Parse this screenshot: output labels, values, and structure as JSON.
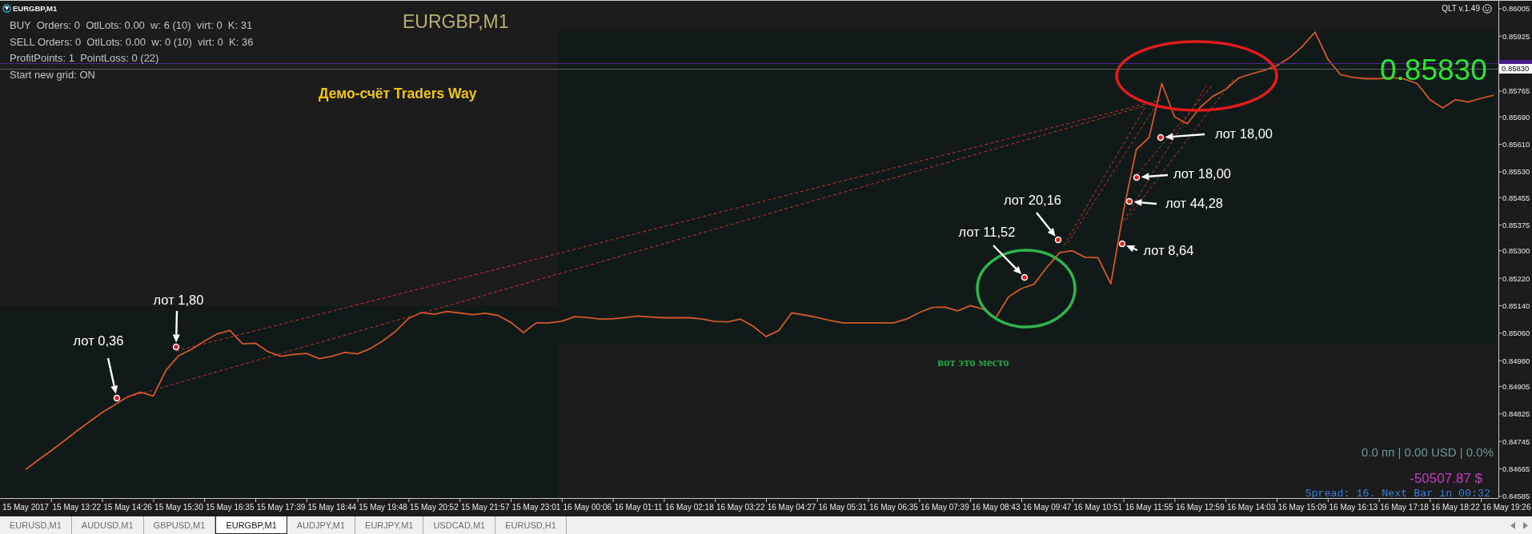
{
  "window": {
    "title": "EURGBP,M1",
    "version": "QLT v.1.49"
  },
  "chart": {
    "info_lines": [
      "BUY  Orders: 0  OtlLots: 0.00  w: 6 (10)  virt: 0  K: 31",
      "SELL Orders: 0  OtlLots: 0.00  w: 0 (10)  virt: 0  K: 36",
      "ProfitPoints: 1  PointLoss: 0 (22)",
      "Start new grid: ON"
    ],
    "symbol": "EURGBP,M1",
    "account_label": "Демо-счёт Traders Way",
    "big_price": "0.85830",
    "price_tag": "0.85830",
    "lot_labels": [
      "лот 18,00",
      "лот 18,00",
      "лот 20,16",
      "лот 44,28",
      "лот 11,52",
      "лот 8,64",
      "лот 1,80",
      "лот 0,36"
    ],
    "note": "вот это место",
    "profit_summary": "0.0 пп | 0.00 USD | 0.0%",
    "balance": "-50507.87 $",
    "spread_info": "Spread: 16. Next Bar in 00:32",
    "chart_data": {
      "type": "line",
      "categories": [
        "15 May 2017",
        null,
        null,
        null,
        "15 May 13:22",
        null,
        null,
        null,
        "15 May 14:26",
        null,
        null,
        null,
        "15 May 15:30",
        null,
        null,
        null,
        "15 May 16:35",
        null,
        null,
        null,
        "15 May 17:39",
        null,
        null,
        null,
        "15 May 18:44",
        null,
        null,
        null,
        "15 May 19:48",
        null,
        null,
        null,
        "15 May 20:52",
        null,
        null,
        null,
        "15 May 21:57",
        null,
        null,
        null,
        "15 May 23:01",
        null,
        null,
        null,
        "16 May 00:06",
        null,
        null,
        null,
        "16 May 01:11",
        null,
        null,
        null,
        "16 May 02:18",
        null,
        null,
        null,
        "16 May 03:22",
        null,
        null,
        null,
        "16 May 04:27",
        null,
        null,
        null,
        "16 May 05:31",
        null,
        null,
        null,
        "16 May 06:35",
        null,
        null,
        null,
        "16 May 07:39",
        null,
        null,
        null,
        "16 May 08:43",
        null,
        null,
        null,
        "16 May 09:47",
        null,
        null,
        null,
        "16 May 10:51",
        null,
        null,
        null,
        "16 May 11:55",
        null,
        null,
        null,
        "16 May 12:59",
        null,
        null,
        null,
        "16 May 14:03",
        null,
        null,
        null,
        "16 May 15:09",
        null,
        null,
        null,
        "16 May 16:13",
        null,
        null,
        null,
        "16 May 17:18",
        null,
        null,
        null,
        "16 May 18:22",
        null,
        null,
        null,
        "16 May 19:26",
        null
      ],
      "series": [
        {
          "color": "#d4572a",
          "values": [
            0.84663,
            0.84691,
            0.84718,
            0.84746,
            0.84775,
            0.84802,
            0.84829,
            0.84852,
            0.84875,
            0.84888,
            0.84877,
            0.84952,
            0.84995,
            0.85013,
            0.85037,
            0.85058,
            0.85068,
            0.85029,
            0.85031,
            0.85006,
            0.84993,
            0.84998,
            0.85001,
            0.84986,
            0.84993,
            0.85004,
            0.85,
            0.85015,
            0.85038,
            0.85066,
            0.85103,
            0.8512,
            0.85115,
            0.85123,
            0.85119,
            0.85114,
            0.85118,
            0.85112,
            0.85092,
            0.85062,
            0.8509,
            0.8509,
            0.85095,
            0.85108,
            0.85106,
            0.85101,
            0.85102,
            0.85106,
            0.8511,
            0.85107,
            0.85105,
            0.85105,
            0.85105,
            0.85101,
            0.85094,
            0.85093,
            0.85101,
            0.8508,
            0.8505,
            0.85068,
            0.85119,
            0.85113,
            0.85106,
            0.85097,
            0.8509,
            0.8509,
            0.8509,
            0.8509,
            0.8509,
            0.85101,
            0.8512,
            0.85135,
            0.85136,
            0.85125,
            0.8514,
            0.8513,
            0.85105,
            0.85166,
            0.8519,
            0.85203,
            0.85252,
            0.85295,
            0.853,
            0.85281,
            0.8528,
            0.85204,
            0.85417,
            0.85595,
            0.8563,
            0.85787,
            0.8569,
            0.8567,
            0.85718,
            0.8575,
            0.8577,
            0.85803,
            0.85815,
            0.85825,
            0.85839,
            0.85862,
            0.85895,
            0.85937,
            0.85858,
            0.85813,
            0.85805,
            0.85801,
            0.85801,
            0.85805,
            0.858,
            0.85787,
            0.8574,
            0.85716,
            0.8574,
            0.85733,
            0.85744,
            0.85753,
            null,
            null
          ]
        }
      ],
      "ylim": [
        0.8458,
        0.86028
      ],
      "yticks": [
        0.86005,
        0.85925,
        0.85765,
        {
          "value": 0.8569,
          "label": "0.85690"
        },
        {
          "value": 0.8561,
          "label": "0.85610"
        },
        {
          "value": 0.8553,
          "label": "0.85530"
        },
        0.85455,
        0.85375,
        {
          "value": 0.853,
          "label": "0.85300"
        },
        {
          "value": 0.8522,
          "label": "0.85220"
        },
        {
          "value": 0.8514,
          "label": "0.85140"
        },
        {
          "value": 0.8506,
          "label": "0.85060"
        },
        {
          "value": 0.8498,
          "label": "0.84980"
        },
        0.84905,
        0.84825,
        0.84745,
        0.84665,
        0.84585
      ]
    }
  },
  "tabs": [
    {
      "label": "EURUSD,M1",
      "selected": false
    },
    {
      "label": "AUDUSD,M1",
      "selected": false
    },
    {
      "label": "GBPUSD,M1",
      "selected": false
    },
    {
      "label": "EURGBP,M1",
      "selected": true
    },
    {
      "label": "AUDJPY,M1",
      "selected": false
    },
    {
      "label": "EURJPY,M1",
      "selected": false
    },
    {
      "label": "USDCAD,M1",
      "selected": false
    },
    {
      "label": "EURUSD,H1",
      "selected": false
    }
  ]
}
